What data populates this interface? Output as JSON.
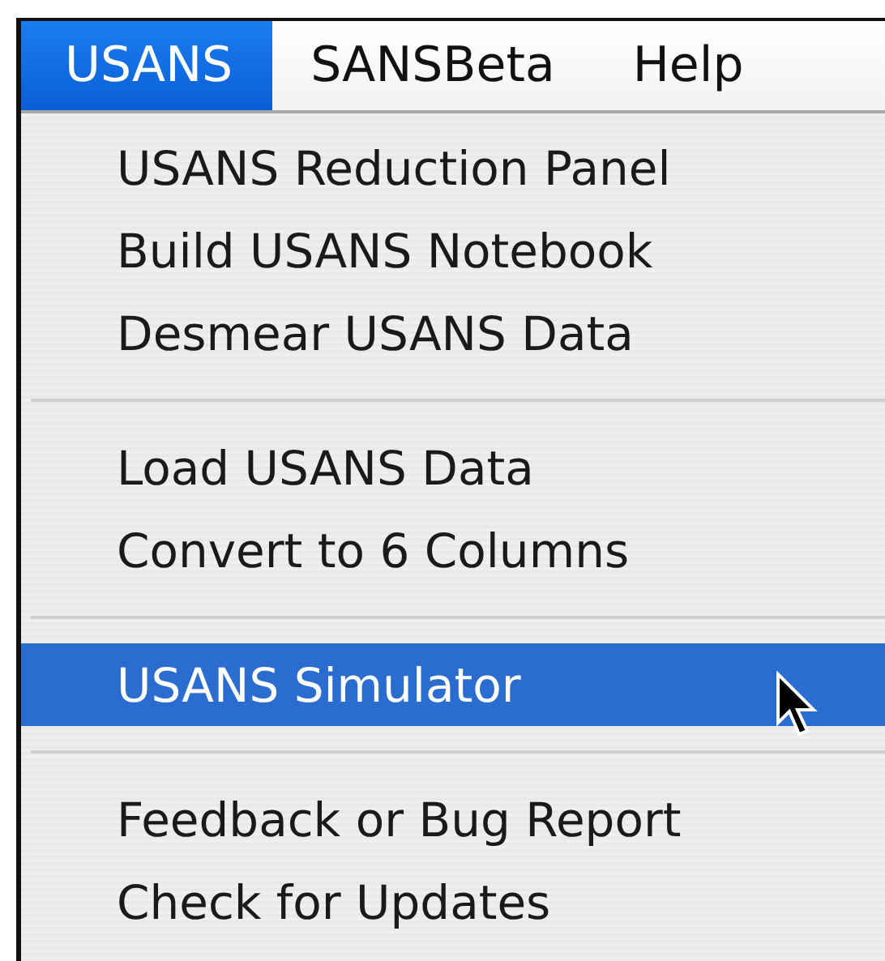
{
  "menubar": {
    "menus": [
      {
        "label": "USANS",
        "selected": true
      },
      {
        "label": "SANSBeta",
        "selected": false
      },
      {
        "label": "Help",
        "selected": false
      }
    ]
  },
  "menu": {
    "items": [
      {
        "kind": "item",
        "label": "USANS Reduction Panel",
        "selected": false
      },
      {
        "kind": "item",
        "label": "Build USANS Notebook",
        "selected": false
      },
      {
        "kind": "item",
        "label": "Desmear USANS Data",
        "selected": false
      },
      {
        "kind": "separator"
      },
      {
        "kind": "item",
        "label": "Load USANS Data",
        "selected": false
      },
      {
        "kind": "item",
        "label": "Convert to 6 Columns",
        "selected": false
      },
      {
        "kind": "separator"
      },
      {
        "kind": "item",
        "label": "USANS Simulator",
        "selected": true
      },
      {
        "kind": "separator"
      },
      {
        "kind": "item",
        "label": "Feedback or Bug Report",
        "selected": false
      },
      {
        "kind": "item",
        "label": "Check for Updates",
        "selected": false
      }
    ]
  }
}
